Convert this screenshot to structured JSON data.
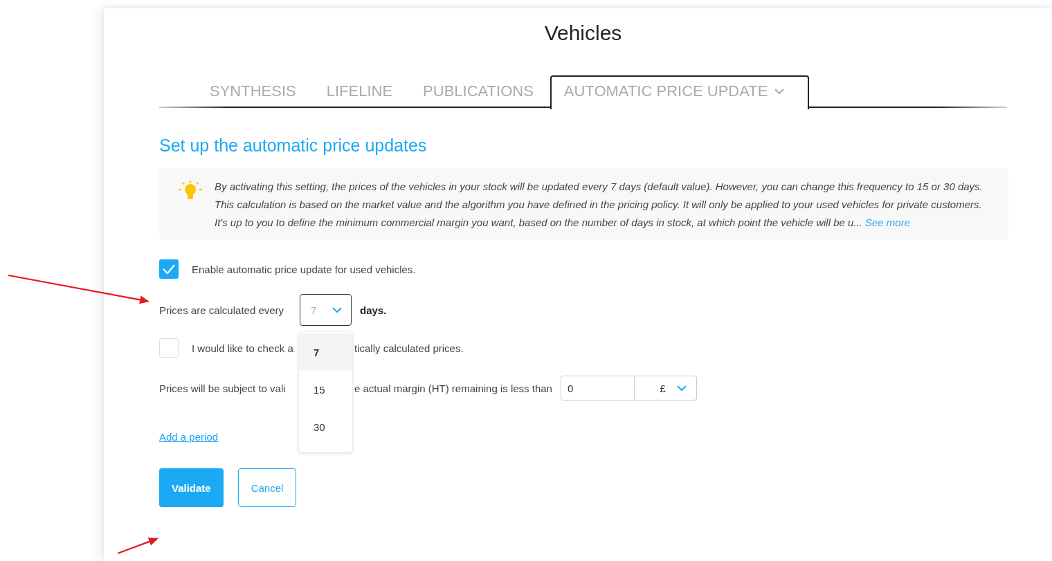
{
  "page_title": "Vehicles",
  "tabs": [
    {
      "label": "SYNTHESIS",
      "selected": false,
      "has_menu": false
    },
    {
      "label": "LIFELINE",
      "selected": false,
      "has_menu": false
    },
    {
      "label": "PUBLICATIONS",
      "selected": false,
      "has_menu": false
    },
    {
      "label": "AUTOMATIC PRICE UPDATE",
      "selected": true,
      "has_menu": true
    }
  ],
  "section_title": "Set up the automatic price updates",
  "info": {
    "paragraphs": [
      "By activating this setting, the prices of the vehicles in your stock will be updated every 7 days (default value). However, you can change this frequency to 15 or 30 days.",
      "This calculation is based on the market value and the algorithm you have defined in the pricing policy. It will only be applied to your used vehicles for private customers. It's up to you to define the minimum commercial margin you want, based on the number of days in stock, at which point the vehicle will be u..."
    ],
    "link": "See more"
  },
  "enable": {
    "label": "Enable automatic price update for used vehicles.",
    "checked": true
  },
  "frequency": {
    "label": "Prices are calculated every",
    "value": "7",
    "unit": "days.",
    "expanded": true,
    "options": [
      {
        "label": "7",
        "selected": true
      },
      {
        "label": "15",
        "selected": false
      },
      {
        "label": "30",
        "selected": false
      }
    ]
  },
  "check": {
    "label_parts": [
      "I would like to check a",
      "tically calculated prices."
    ],
    "checked": false
  },
  "margin": {
    "label_parts": [
      "Prices will be subject to vali",
      "e actual margin (HT) remaining is less than"
    ],
    "value": "0",
    "currency": "£"
  },
  "add_period": "Add a period",
  "buttons": [
    {
      "label": "Validate",
      "kind": "primary"
    },
    {
      "label": "Cancel",
      "kind": "secondary"
    }
  ]
}
